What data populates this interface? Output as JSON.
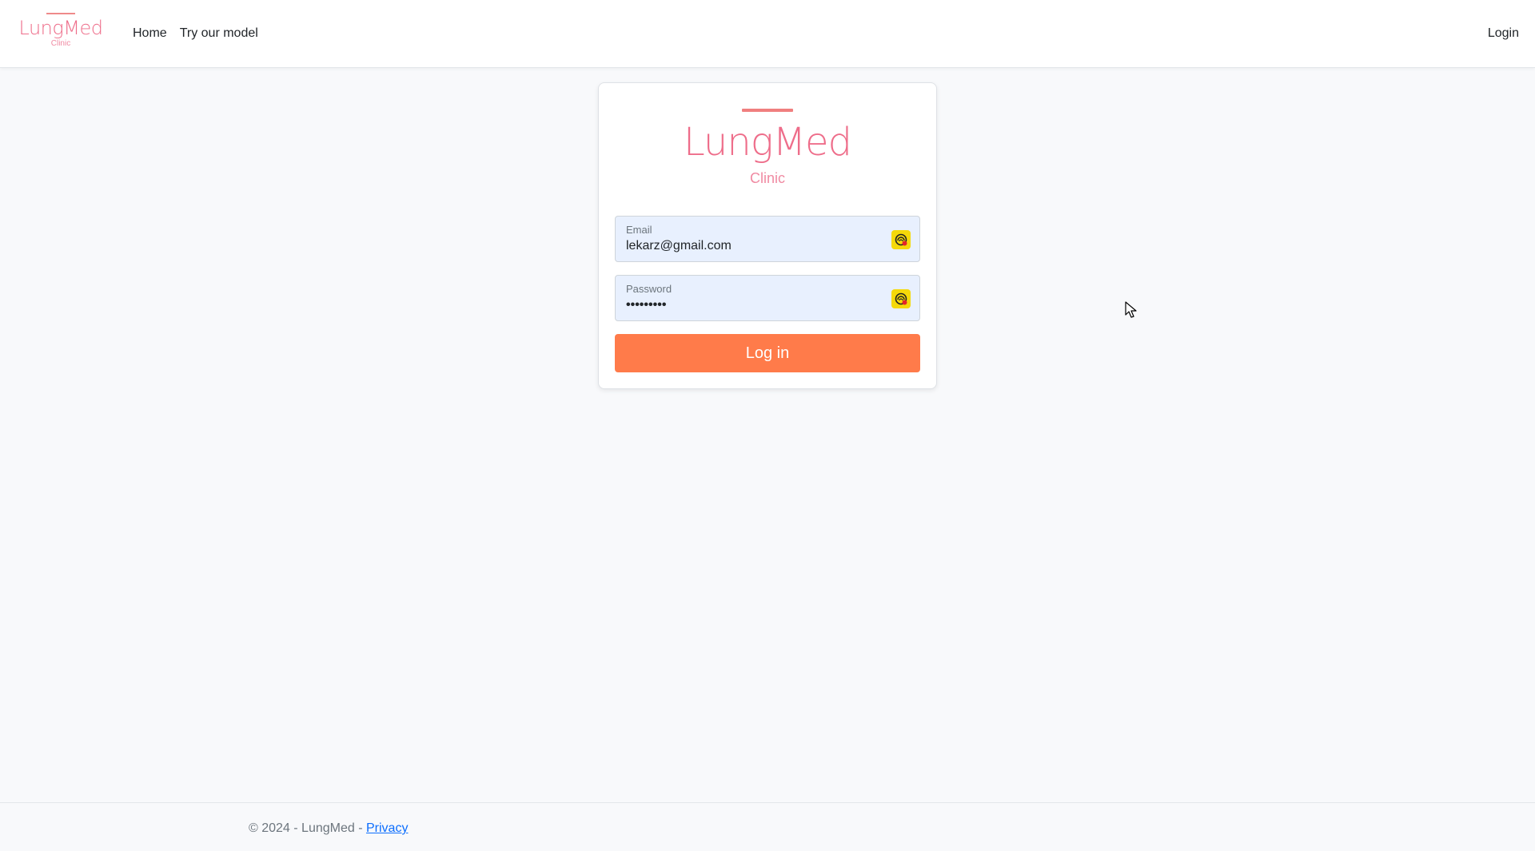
{
  "navbar": {
    "logo": {
      "brand": "LungMed",
      "sub": "Clinic"
    },
    "links": [
      {
        "label": "Home"
      },
      {
        "label": "Try our model"
      }
    ],
    "login_label": "Login"
  },
  "login_card": {
    "logo": {
      "brand": "LungMed",
      "sub": "Clinic"
    },
    "email": {
      "label": "Email",
      "value": "lekarz@gmail.com"
    },
    "password": {
      "label": "Password",
      "value": "•••••••••"
    },
    "submit_label": "Log in"
  },
  "footer": {
    "copyright": "© 2024 - LungMed - ",
    "privacy_label": "Privacy"
  },
  "colors": {
    "brand_pink": "#ee6d8a",
    "button_orange": "#ff7b4a",
    "autofill_bg": "#e8f0fe",
    "link_blue": "#0d6efd",
    "password_manager_icon": "#f5d90a"
  },
  "icons": [
    "password-manager-icon",
    "mouse-cursor-icon"
  ]
}
